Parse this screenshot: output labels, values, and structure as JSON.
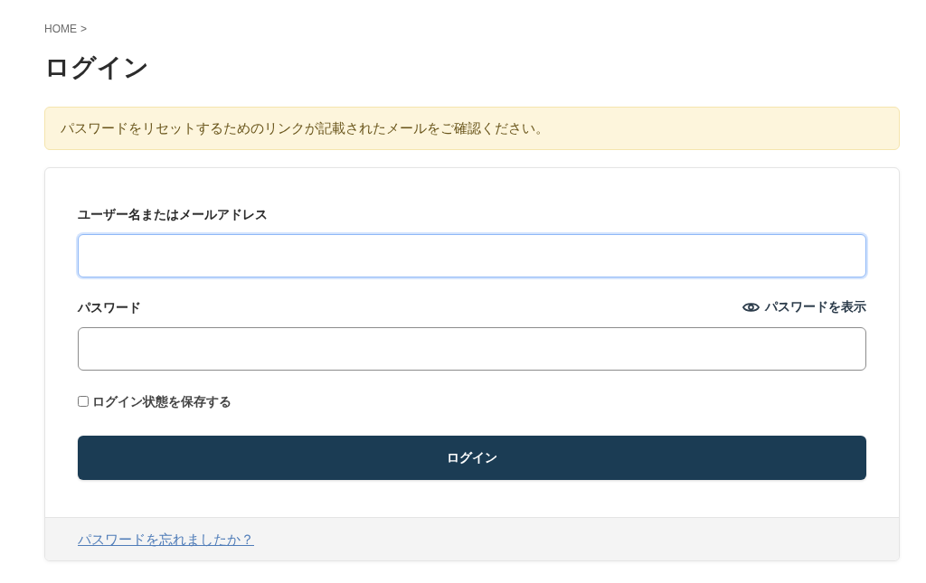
{
  "breadcrumb": {
    "label": "HOME",
    "separator": ">"
  },
  "title": "ログイン",
  "notice": "パスワードをリセットするためのリンクが記載されたメールをご確認ください。",
  "form": {
    "fields": [
      {
        "label": "ユーザー名またはメールアドレス",
        "focused": true
      },
      {
        "label": "パスワード",
        "focused": false,
        "toggle": {
          "label": "パスワードを表示"
        }
      }
    ],
    "remember": {
      "label": "ログイン状態を保存する",
      "checked": false
    },
    "submit": "ログイン"
  },
  "footer": {
    "link": "パスワードを忘れましたか？"
  }
}
